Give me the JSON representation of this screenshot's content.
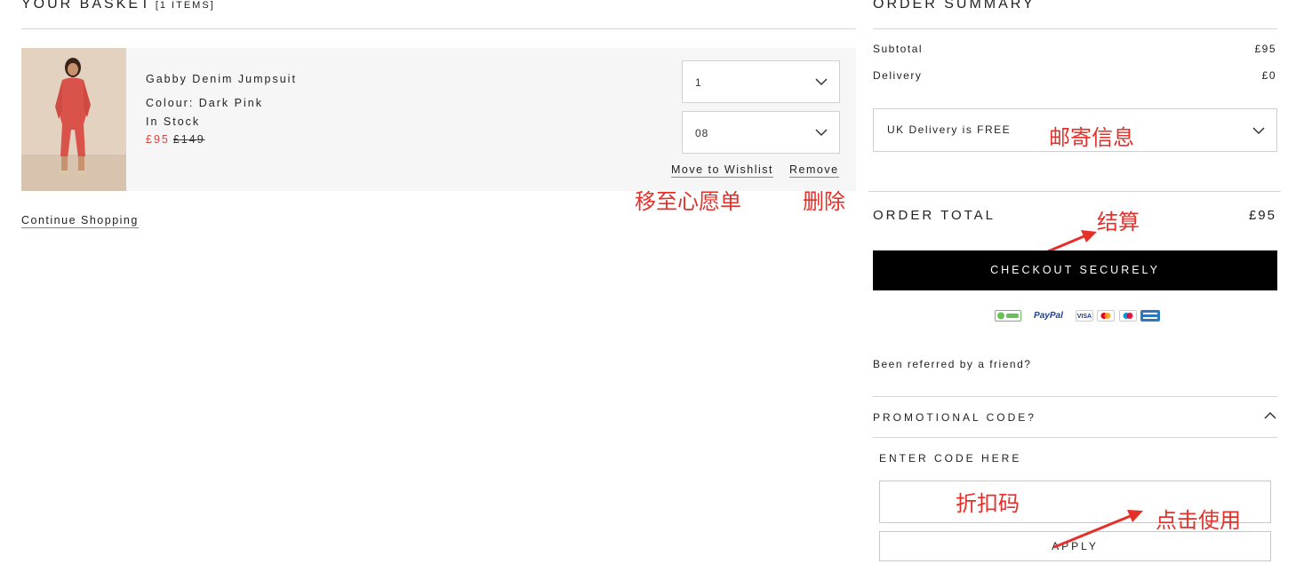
{
  "basket": {
    "title": "YOUR BASKET",
    "count": "[1 ITEMS]",
    "item": {
      "name": "Gabby Denim Jumpsuit",
      "colour": "Colour: Dark Pink",
      "stock": "In Stock",
      "price_now": "£95",
      "price_was": "£149",
      "quantity": "1",
      "size": "08",
      "wishlist_label": "Move to Wishlist",
      "remove_label": "Remove"
    },
    "continue_label": "Continue Shopping"
  },
  "summary": {
    "title": "ORDER SUMMARY",
    "subtotal_label": "Subtotal",
    "subtotal_value": "£95",
    "delivery_label": "Delivery",
    "delivery_value": "£0",
    "delivery_option": "UK Delivery is FREE",
    "total_label": "ORDER TOTAL",
    "total_value": "£95",
    "checkout_label": "CHECKOUT SECURELY",
    "payment_methods": {
      "clearpay": "",
      "paypal": "PayPal",
      "visa": "VISA",
      "amex": ""
    },
    "referred_label": "Been referred by a friend?",
    "promo_label": "PROMOTIONAL CODE?",
    "enter_code_label": "ENTER CODE HERE",
    "code_value": "",
    "apply_label": "APPLY"
  },
  "annotations": {
    "delivery_info": "邮寄信息",
    "move_to_wishlist": "移至心愿单",
    "delete": "删除",
    "checkout": "结算",
    "promo_code": "折扣码",
    "click_to_use": "点击使用"
  },
  "colors": {
    "accent_red": "#d6463f",
    "annotation_red": "#e5302a",
    "checkout_bg": "#000000"
  }
}
